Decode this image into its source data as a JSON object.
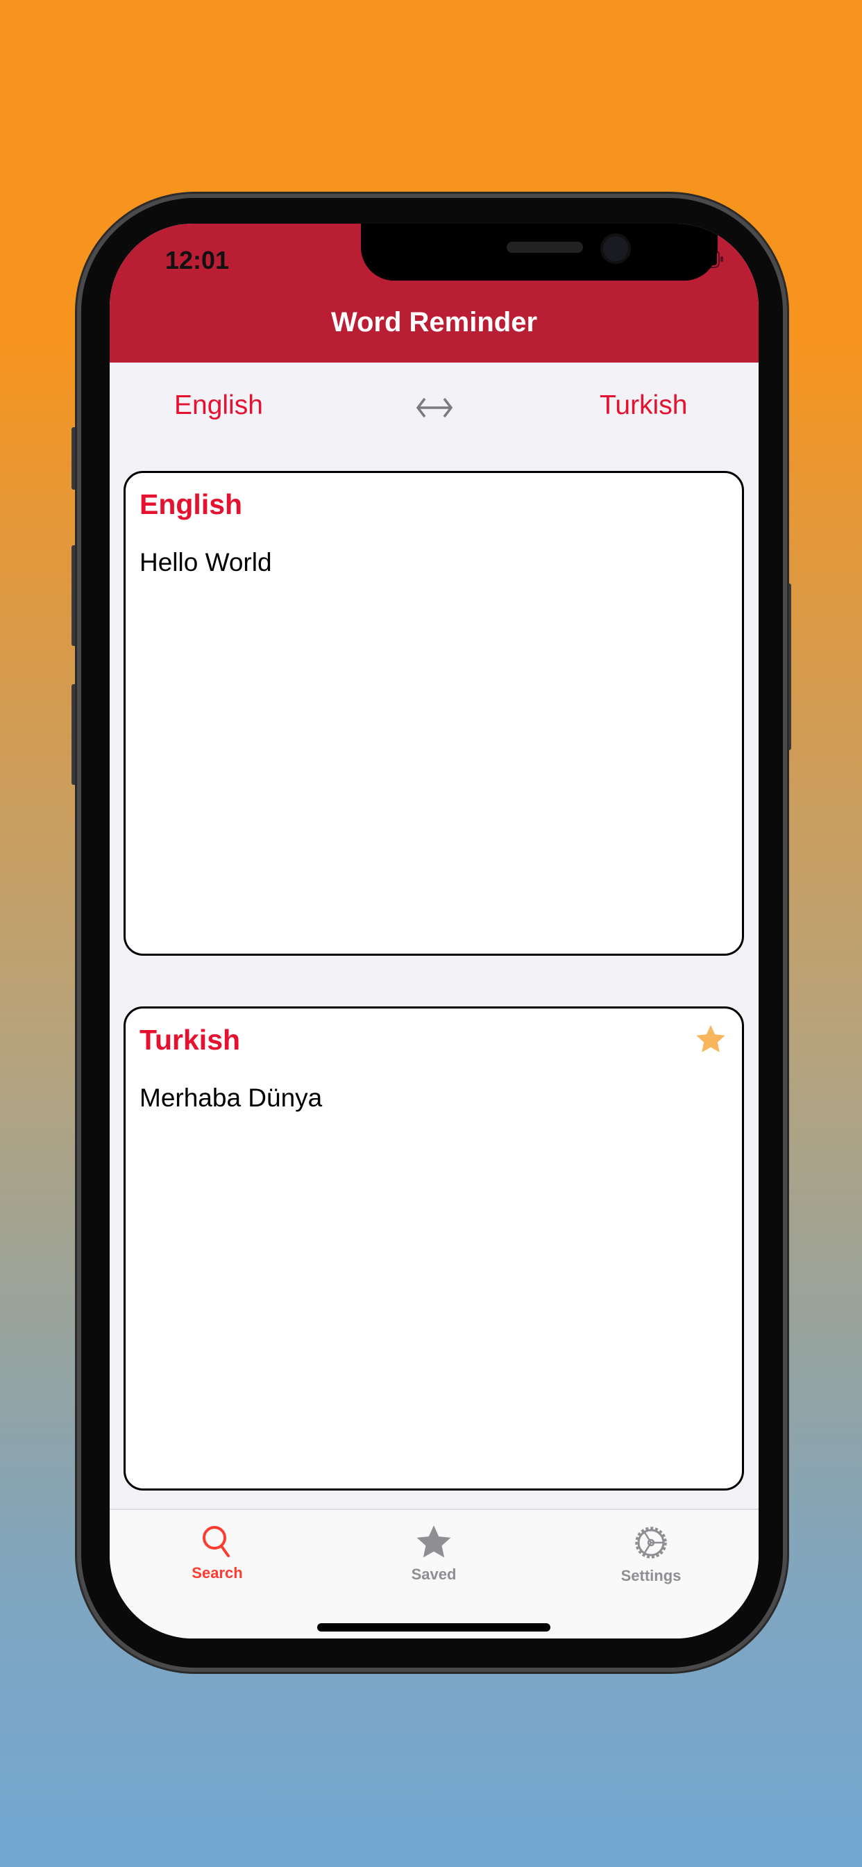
{
  "status_bar": {
    "time": "12:01"
  },
  "header": {
    "title": "Word Reminder"
  },
  "language_selector": {
    "source": "English",
    "target": "Turkish",
    "swap_icon": "left-right-arrow-icon"
  },
  "source_card": {
    "label": "English",
    "text": "Hello World"
  },
  "target_card": {
    "label": "Turkish",
    "text": "Merhaba Dünya",
    "saved_icon": "star-icon",
    "star_color": "#F9B55C"
  },
  "tab_bar": {
    "tabs": [
      {
        "label": "Search",
        "icon": "search-icon",
        "active": true
      },
      {
        "label": "Saved",
        "icon": "star-icon",
        "active": false
      },
      {
        "label": "Settings",
        "icon": "gear-icon",
        "active": false
      }
    ]
  },
  "colors": {
    "header": "#B91E34",
    "accent": "#E6102F",
    "tab_active": "#FF3B30",
    "tab_inactive": "#8E8E93"
  }
}
